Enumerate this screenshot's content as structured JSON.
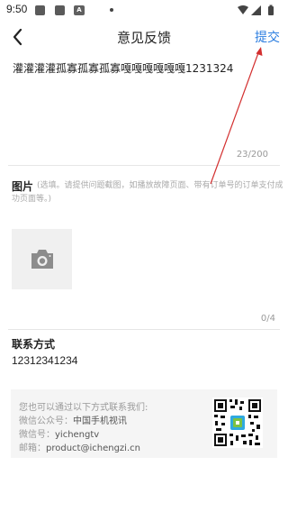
{
  "status_bar": {
    "time": "9:50",
    "icons": [
      "image-icon",
      "image-icon",
      "a-icon",
      "dot-icon",
      "wifi-icon",
      "signal-icon",
      "battery-icon"
    ],
    "a_letter": "A"
  },
  "nav": {
    "title": "意见反馈",
    "submit_label": "提交",
    "back_icon": "chevron-left-icon"
  },
  "feedback": {
    "text": "灌灌灌灌孤寡孤寡孤寡嘎嘎嘎嘎嘎嘎1231324",
    "count": "23/200"
  },
  "images": {
    "label": "图片",
    "hint": "(选填。请提供问题截图，如播放故障页面、带有订单号的订单支付成功页面等。)",
    "count": "0/4",
    "add_icon": "camera-icon"
  },
  "contact": {
    "label": "联系方式",
    "value": "12312341234"
  },
  "info": {
    "intro": "您也可以通过以下方式联系我们:",
    "wechat_official_label": "微信公众号：",
    "wechat_official_value": "中国手机视讯",
    "wechat_id_label": "微信号：",
    "wechat_id_value": "yichengtv",
    "email_label": "邮箱：",
    "email_value": "product@ichengzi.cn",
    "qr_icon": "qr-code-icon"
  },
  "colors": {
    "accent": "#2b7de0",
    "annotation_arrow": "#d32f2f"
  }
}
